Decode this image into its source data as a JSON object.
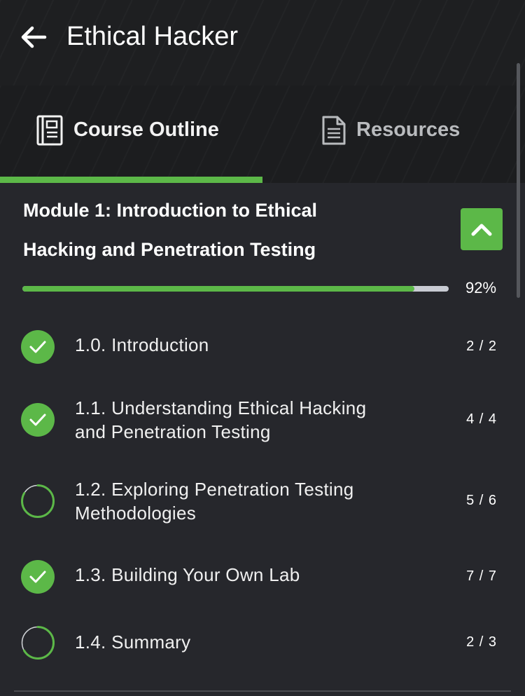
{
  "header": {
    "title": "Ethical Hacker",
    "back_icon": "arrow-left-icon"
  },
  "tabs": [
    {
      "label": "Course Outline",
      "icon": "book-icon",
      "active": true
    },
    {
      "label": "Resources",
      "icon": "document-icon",
      "active": false
    }
  ],
  "colors": {
    "accent": "#5cb848",
    "background": "#26272c",
    "header": "#1e1f21",
    "track": "#c8cbd3"
  },
  "module": {
    "title_line1": "Module 1: Introduction to Ethical",
    "title_line2": "Hacking and Penetration Testing",
    "progress_label": "92%",
    "progress_value": 0.92,
    "collapse_icon": "chevron-up-icon"
  },
  "items": [
    {
      "line1": "1.0. Introduction",
      "line2": "",
      "count": "2 / 2",
      "status": "complete",
      "fraction": 1.0
    },
    {
      "line1": "1.1. Understanding Ethical Hacking",
      "line2": "and Penetration Testing",
      "count": "4 / 4",
      "status": "complete",
      "fraction": 1.0
    },
    {
      "line1": "1.2. Exploring Penetration Testing",
      "line2": "Methodologies",
      "count": "5 / 6",
      "status": "in-progress",
      "fraction": 0.8333
    },
    {
      "line1": "1.3. Building Your Own Lab",
      "line2": "",
      "count": "7 / 7",
      "status": "complete",
      "fraction": 1.0
    },
    {
      "line1": "1.4. Summary",
      "line2": "",
      "count": "2 / 3",
      "status": "in-progress",
      "fraction": 0.6667
    }
  ]
}
